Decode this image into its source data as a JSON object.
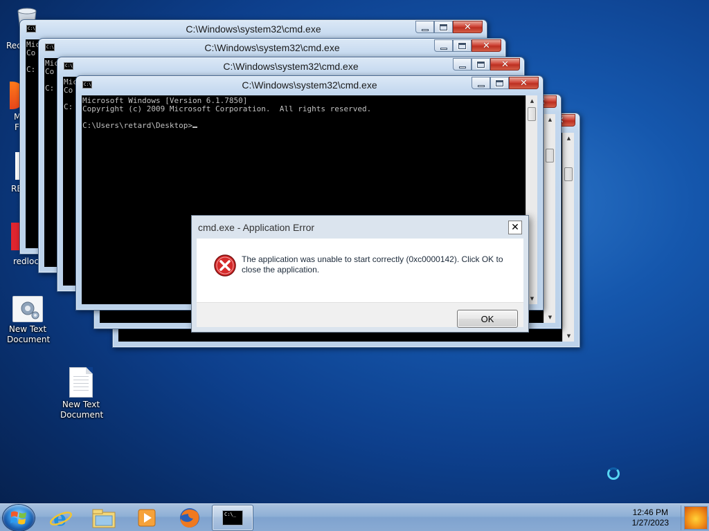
{
  "desktop": {
    "icons": [
      {
        "label": "New Text Document",
        "icon": "settings-icon"
      },
      {
        "label": "New Text Document",
        "icon": "text-document-icon"
      }
    ],
    "partial_labels": [
      "Rec",
      "M",
      "F",
      "RE",
      "redlock"
    ]
  },
  "cmd_windows": [
    {
      "title": "C:\\Windows\\system32\\cmd.exe",
      "partial_lines": [
        "Mic",
        "Co",
        "",
        "C:"
      ]
    },
    {
      "title": "C:\\Windows\\system32\\cmd.exe",
      "partial_lines": [
        "Mic",
        "Co",
        "",
        "C:"
      ]
    },
    {
      "title": "C:\\Windows\\system32\\cmd.exe",
      "partial_lines": [
        "Mic",
        "Co",
        "",
        "C:"
      ]
    },
    {
      "title": "C:\\Windows\\system32\\cmd.exe",
      "lines": [
        "Microsoft Windows [Version 6.1.7850]",
        "Copyright (c) 2009 Microsoft Corporation.  All rights reserved.",
        "",
        "C:\\Users\\retard\\Desktop>"
      ]
    }
  ],
  "error_dialog": {
    "title": "cmd.exe - Application Error",
    "message": "The application was unable to start correctly (0xc0000142). Click OK to close the application.",
    "ok_label": "OK",
    "close_glyph": "✕",
    "icon": "error-icon"
  },
  "taskbar": {
    "apps": [
      {
        "name": "internet-explorer-icon"
      },
      {
        "name": "windows-explorer-icon"
      },
      {
        "name": "media-player-icon"
      },
      {
        "name": "firefox-icon"
      },
      {
        "name": "cmd-icon",
        "active": true
      }
    ],
    "clock": {
      "time": "12:46 PM",
      "date": "1/27/2023"
    }
  },
  "colors": {
    "console_bg": "#000000",
    "console_text": "#c0c0c0",
    "close_button": "#c8382a",
    "taskbar": "#8fb0d6"
  }
}
